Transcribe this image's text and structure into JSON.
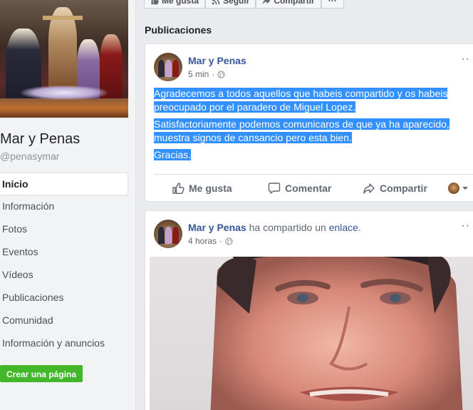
{
  "sidebar": {
    "page_name": "Mar y Penas",
    "page_handle": "@penasymar",
    "nav": [
      {
        "label": "Inicio",
        "active": true
      },
      {
        "label": "Información",
        "active": false
      },
      {
        "label": "Fotos",
        "active": false
      },
      {
        "label": "Eventos",
        "active": false
      },
      {
        "label": "Vídeos",
        "active": false
      },
      {
        "label": "Publicaciones",
        "active": false
      },
      {
        "label": "Comunidad",
        "active": false
      },
      {
        "label": "Información y anuncios",
        "active": false
      }
    ],
    "create_page_label": "Crear una página"
  },
  "topbar": {
    "like_label": "Me gusta",
    "follow_label": "Seguir",
    "share_label": "Compartir",
    "more_label": "···"
  },
  "section_title": "Publicaciones",
  "posts": [
    {
      "author": "Mar y Penas",
      "time": "5 min",
      "separator": "·",
      "paragraphs": [
        "Agradecemos a todos aquellos que habeis compartido y os habeis preocupado por el paradero de Miguel Lopez.",
        "Satisfactoriamente podemos comunicaros de que ya ha aparecido, muestra signos de cansancio pero esta bien.",
        "Gracias."
      ],
      "actions": {
        "like": "Me gusta",
        "comment": "Comentar",
        "share": "Compartir"
      }
    },
    {
      "author": "Mar y Penas",
      "shared_prefix": "ha compartido un",
      "shared_link": "enlace",
      "shared_suffix": ".",
      "time": "4 horas",
      "separator": "·"
    }
  ],
  "colors": {
    "link": "#365899",
    "selection": "#3390ff",
    "create_button": "#42b72a",
    "sidebar_bg": "#f2f3f5",
    "page_bg": "#e9ebee"
  },
  "icons": [
    "thumbs-up-icon",
    "rss-icon",
    "share-arrow-icon",
    "globe-icon",
    "comment-icon",
    "caret-down-icon",
    "more-dots-icon"
  ]
}
